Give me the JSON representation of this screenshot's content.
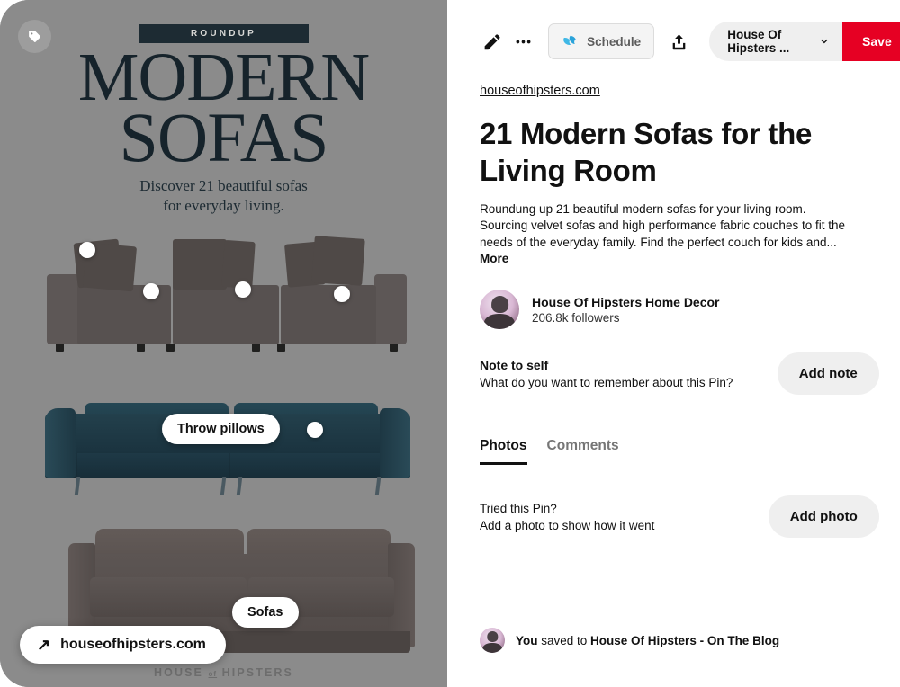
{
  "image_pane": {
    "tag_fab_icon": "tag-icon",
    "cover": {
      "badge": "ROUNDUP",
      "title_line1": "MODERN",
      "title_line2": "SOFAS",
      "subtitle_line1": "Discover 21 beautiful sofas",
      "subtitle_line2": "for everyday living.",
      "footer_pre": "HOUSE",
      "footer_mid": "of",
      "footer_post": "HIPSTERS",
      "background_color": "#8b8b8b",
      "ink_color": "#16232b"
    },
    "tags": [
      {
        "label": "Throw pillows"
      },
      {
        "label": "Sofas"
      }
    ],
    "site_pill": {
      "icon": "arrow-up-right-icon",
      "host": "houseofhipsters.com"
    },
    "hotspots": 5
  },
  "action_bar": {
    "edit_icon": "pencil-icon",
    "more_icon": "ellipsis-icon",
    "schedule_label": "Schedule",
    "schedule_icon": "tailwind-bird-icon",
    "share_icon": "share-upload-icon",
    "board_name": "House Of Hipsters ...",
    "board_chevron_icon": "chevron-down-icon",
    "save_label": "Save",
    "save_color": "#e60023"
  },
  "pin": {
    "source_link": "houseofhipsters.com",
    "title": "21 Modern Sofas for the Living Room",
    "description": "Roundung up 21 beautiful modern sofas for your living room. Sourcing velvet sofas and high performance fabric couches to fit the needs of the everyday family. Find the perfect couch for kids and...",
    "more_label": "More"
  },
  "creator": {
    "name": "House Of Hipsters Home Decor",
    "followers": "206.8k followers"
  },
  "note": {
    "title": "Note to self",
    "prompt": "What do you want to remember about this Pin?",
    "button_label": "Add note"
  },
  "tabs": [
    {
      "label": "Photos",
      "active": true
    },
    {
      "label": "Comments",
      "active": false
    }
  ],
  "photos_section": {
    "line1": "Tried this Pin?",
    "line2": "Add a photo to show how it went",
    "button_label": "Add photo"
  },
  "saved": {
    "who": "You",
    "middle": " saved to ",
    "board": "House Of Hipsters - On The Blog"
  }
}
